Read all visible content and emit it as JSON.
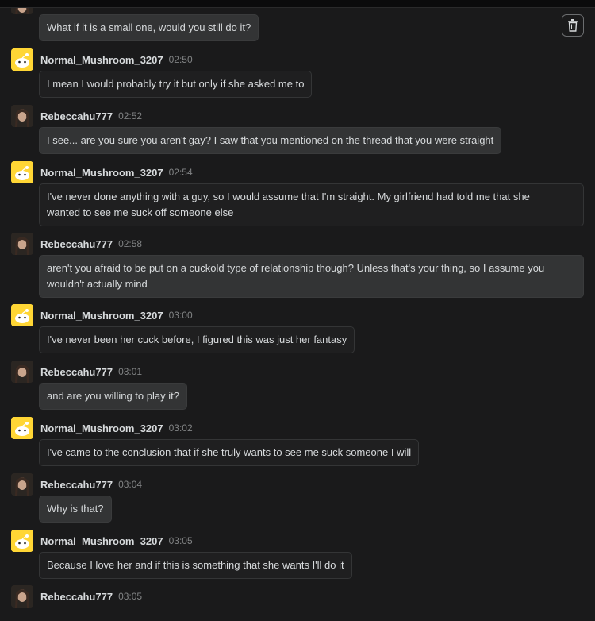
{
  "first_message": "What if it is a small one, would you still do it?",
  "messages": [
    {
      "user": "Normal_Mushroom_3207",
      "time": "02:50",
      "text": "I mean I would probably try it but only if she asked me to"
    },
    {
      "user": "Rebeccahu777",
      "time": "02:52",
      "text": "I see... are you sure you aren't gay? I saw that you mentioned on the thread that you were straight"
    },
    {
      "user": "Normal_Mushroom_3207",
      "time": "02:54",
      "text_line1": "I've never done anything with a guy, so I would assume that I'm straight. My girlfriend had told me that she",
      "text_line2": "wanted to see me suck off someone else"
    },
    {
      "user": "Rebeccahu777",
      "time": "02:58",
      "text_line1": "aren't you afraid to be put on a cuckold type of relationship though? Unless that's your thing, so I assume you",
      "text_line2": "wouldn't actually mind"
    },
    {
      "user": "Normal_Mushroom_3207",
      "time": "03:00",
      "text": "I've never been her cuck before, I figured this was just her fantasy"
    },
    {
      "user": "Rebeccahu777",
      "time": "03:01",
      "text": "and are you willing to play it?"
    },
    {
      "user": "Normal_Mushroom_3207",
      "time": "03:02",
      "text": "I've came to the conclusion that if she truly wants to see me suck someone I will"
    },
    {
      "user": "Rebeccahu777",
      "time": "03:04",
      "text": "Why is that?"
    },
    {
      "user": "Normal_Mushroom_3207",
      "time": "03:05",
      "text": "Because I love her and if this is something that she wants I'll do it"
    },
    {
      "user": "Rebeccahu777",
      "time": "03:05"
    }
  ],
  "icons": {
    "delete": "trash-icon",
    "snoo_avatar": "snoo-avatar-icon",
    "photo_avatar": "profile-photo"
  },
  "colors": {
    "background": "#1a1a1b",
    "bubble": "#2a2a2b",
    "snoo": "#ffd635",
    "timestamp": "#818384"
  }
}
